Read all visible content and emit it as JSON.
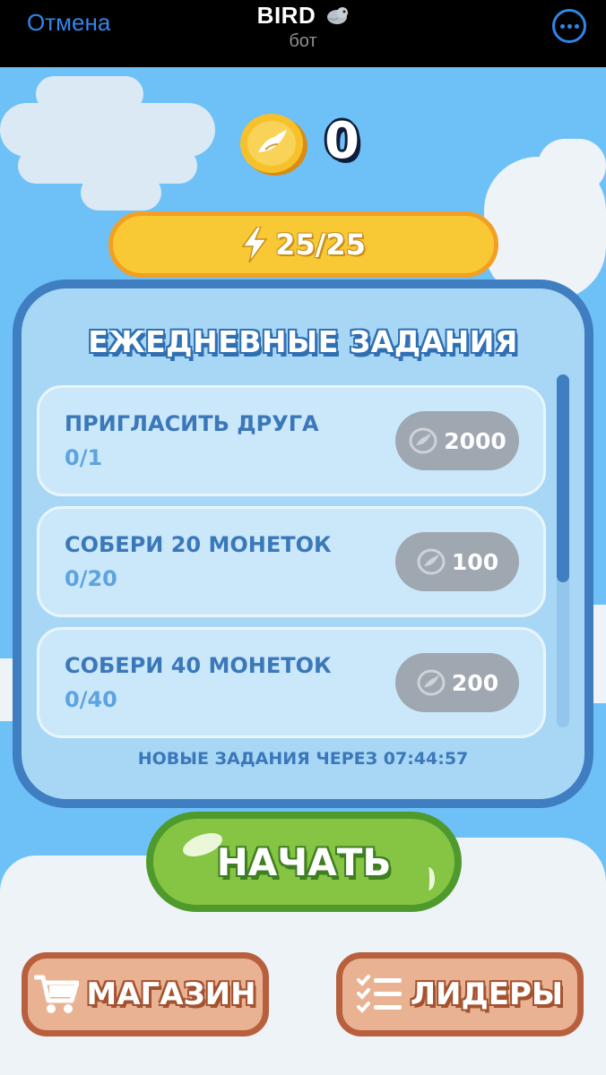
{
  "topbar": {
    "cancel_label": "Отмена",
    "bot_name": "BIRD",
    "bot_subtitle": "бот"
  },
  "balance": {
    "coins": "0"
  },
  "energy": {
    "label": "25/25"
  },
  "daily_tasks": {
    "title": "ЕЖЕДНЕВНЫЕ ЗАДАНИЯ",
    "tasks": [
      {
        "name": "ПРИГЛАСИТЬ ДРУГА",
        "progress": "0/1",
        "reward": "2000"
      },
      {
        "name": "СОБЕРИ 20 МОНЕТОК",
        "progress": "0/20",
        "reward": "100"
      },
      {
        "name": "СОБЕРИ 40 МОНЕТОК",
        "progress": "0/40",
        "reward": "200"
      }
    ],
    "timer_label": "НОВЫЕ ЗАДАНИЯ ЧЕРЕЗ  07:44:57"
  },
  "start_button": {
    "label": "НАЧАТЬ"
  },
  "bottom": {
    "shop_label": "МАГАЗИН",
    "leaders_label": "ЛИДЕРЫ"
  },
  "colors": {
    "sky": "#6ec1f6",
    "panel_border": "#3e7ec1",
    "energy_fill": "#f8c935",
    "start_fill": "#86c443",
    "bottom_fill": "#e9b293",
    "link_blue": "#2f87e8"
  },
  "icons": [
    "bird-emoji-icon",
    "more-icon",
    "coin-icon",
    "lightning-icon",
    "coin-reward-icon",
    "cart-icon",
    "list-icon"
  ]
}
